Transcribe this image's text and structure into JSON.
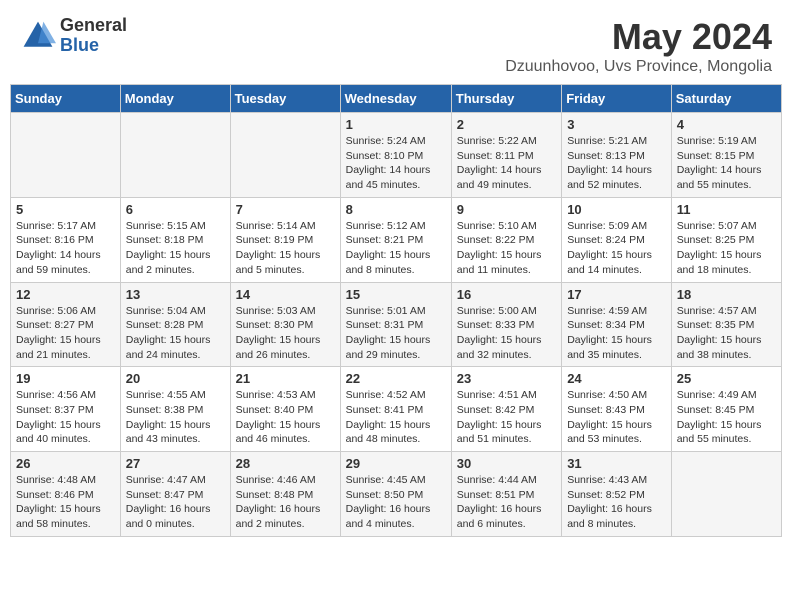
{
  "header": {
    "logo_line1": "General",
    "logo_line2": "Blue",
    "title": "May 2024",
    "subtitle": "Dzuunhovoo, Uvs Province, Mongolia"
  },
  "days_of_week": [
    "Sunday",
    "Monday",
    "Tuesday",
    "Wednesday",
    "Thursday",
    "Friday",
    "Saturday"
  ],
  "weeks": [
    [
      {
        "day": "",
        "info": ""
      },
      {
        "day": "",
        "info": ""
      },
      {
        "day": "",
        "info": ""
      },
      {
        "day": "1",
        "info": "Sunrise: 5:24 AM\nSunset: 8:10 PM\nDaylight: 14 hours\nand 45 minutes."
      },
      {
        "day": "2",
        "info": "Sunrise: 5:22 AM\nSunset: 8:11 PM\nDaylight: 14 hours\nand 49 minutes."
      },
      {
        "day": "3",
        "info": "Sunrise: 5:21 AM\nSunset: 8:13 PM\nDaylight: 14 hours\nand 52 minutes."
      },
      {
        "day": "4",
        "info": "Sunrise: 5:19 AM\nSunset: 8:15 PM\nDaylight: 14 hours\nand 55 minutes."
      }
    ],
    [
      {
        "day": "5",
        "info": "Sunrise: 5:17 AM\nSunset: 8:16 PM\nDaylight: 14 hours\nand 59 minutes."
      },
      {
        "day": "6",
        "info": "Sunrise: 5:15 AM\nSunset: 8:18 PM\nDaylight: 15 hours\nand 2 minutes."
      },
      {
        "day": "7",
        "info": "Sunrise: 5:14 AM\nSunset: 8:19 PM\nDaylight: 15 hours\nand 5 minutes."
      },
      {
        "day": "8",
        "info": "Sunrise: 5:12 AM\nSunset: 8:21 PM\nDaylight: 15 hours\nand 8 minutes."
      },
      {
        "day": "9",
        "info": "Sunrise: 5:10 AM\nSunset: 8:22 PM\nDaylight: 15 hours\nand 11 minutes."
      },
      {
        "day": "10",
        "info": "Sunrise: 5:09 AM\nSunset: 8:24 PM\nDaylight: 15 hours\nand 14 minutes."
      },
      {
        "day": "11",
        "info": "Sunrise: 5:07 AM\nSunset: 8:25 PM\nDaylight: 15 hours\nand 18 minutes."
      }
    ],
    [
      {
        "day": "12",
        "info": "Sunrise: 5:06 AM\nSunset: 8:27 PM\nDaylight: 15 hours\nand 21 minutes."
      },
      {
        "day": "13",
        "info": "Sunrise: 5:04 AM\nSunset: 8:28 PM\nDaylight: 15 hours\nand 24 minutes."
      },
      {
        "day": "14",
        "info": "Sunrise: 5:03 AM\nSunset: 8:30 PM\nDaylight: 15 hours\nand 26 minutes."
      },
      {
        "day": "15",
        "info": "Sunrise: 5:01 AM\nSunset: 8:31 PM\nDaylight: 15 hours\nand 29 minutes."
      },
      {
        "day": "16",
        "info": "Sunrise: 5:00 AM\nSunset: 8:33 PM\nDaylight: 15 hours\nand 32 minutes."
      },
      {
        "day": "17",
        "info": "Sunrise: 4:59 AM\nSunset: 8:34 PM\nDaylight: 15 hours\nand 35 minutes."
      },
      {
        "day": "18",
        "info": "Sunrise: 4:57 AM\nSunset: 8:35 PM\nDaylight: 15 hours\nand 38 minutes."
      }
    ],
    [
      {
        "day": "19",
        "info": "Sunrise: 4:56 AM\nSunset: 8:37 PM\nDaylight: 15 hours\nand 40 minutes."
      },
      {
        "day": "20",
        "info": "Sunrise: 4:55 AM\nSunset: 8:38 PM\nDaylight: 15 hours\nand 43 minutes."
      },
      {
        "day": "21",
        "info": "Sunrise: 4:53 AM\nSunset: 8:40 PM\nDaylight: 15 hours\nand 46 minutes."
      },
      {
        "day": "22",
        "info": "Sunrise: 4:52 AM\nSunset: 8:41 PM\nDaylight: 15 hours\nand 48 minutes."
      },
      {
        "day": "23",
        "info": "Sunrise: 4:51 AM\nSunset: 8:42 PM\nDaylight: 15 hours\nand 51 minutes."
      },
      {
        "day": "24",
        "info": "Sunrise: 4:50 AM\nSunset: 8:43 PM\nDaylight: 15 hours\nand 53 minutes."
      },
      {
        "day": "25",
        "info": "Sunrise: 4:49 AM\nSunset: 8:45 PM\nDaylight: 15 hours\nand 55 minutes."
      }
    ],
    [
      {
        "day": "26",
        "info": "Sunrise: 4:48 AM\nSunset: 8:46 PM\nDaylight: 15 hours\nand 58 minutes."
      },
      {
        "day": "27",
        "info": "Sunrise: 4:47 AM\nSunset: 8:47 PM\nDaylight: 16 hours\nand 0 minutes."
      },
      {
        "day": "28",
        "info": "Sunrise: 4:46 AM\nSunset: 8:48 PM\nDaylight: 16 hours\nand 2 minutes."
      },
      {
        "day": "29",
        "info": "Sunrise: 4:45 AM\nSunset: 8:50 PM\nDaylight: 16 hours\nand 4 minutes."
      },
      {
        "day": "30",
        "info": "Sunrise: 4:44 AM\nSunset: 8:51 PM\nDaylight: 16 hours\nand 6 minutes."
      },
      {
        "day": "31",
        "info": "Sunrise: 4:43 AM\nSunset: 8:52 PM\nDaylight: 16 hours\nand 8 minutes."
      },
      {
        "day": "",
        "info": ""
      }
    ]
  ]
}
